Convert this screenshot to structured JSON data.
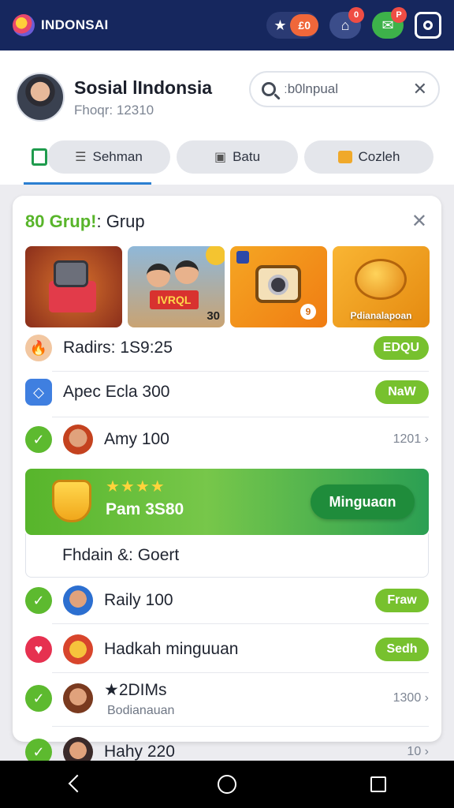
{
  "app": {
    "brand": "INDONSAI"
  },
  "topbar": {
    "star_value": "£0",
    "home_badge": "0",
    "chat_badge": "P"
  },
  "profile": {
    "name": "Sosial lIndonsia",
    "subtitle": "Fhoqr: 12310",
    "search_value": "ːb0lnpual"
  },
  "tabs": [
    {
      "label": "Sehman",
      "icon": "list-icon"
    },
    {
      "label": "Batu",
      "icon": "book-icon"
    },
    {
      "label": "Cozleh",
      "icon": "briefcase-icon"
    }
  ],
  "card": {
    "title_accent": "80 Grup!",
    "title_rest": ": Grup",
    "tiles": [
      {
        "name": "gift-camera-tile"
      },
      {
        "name": "friends-tile",
        "sign": "IVRQL",
        "tag": "30"
      },
      {
        "name": "camera-tile",
        "num": "9"
      },
      {
        "name": "heart-tile",
        "caption": "Pdianalapoan"
      }
    ],
    "rows": [
      {
        "label": "Radirs: 1S9:25",
        "action": "EDQU",
        "lead_icon": "flame-icon"
      },
      {
        "label": "Apec Ecla 300",
        "action": "NaW",
        "lead_icon": "app-icon"
      },
      {
        "label": "Amy 100",
        "meta": "1201 ›",
        "lead_icon": "check-icon"
      }
    ],
    "promo": {
      "stars": "★★★★",
      "text": "Pam 3S80",
      "cta": "Minguaɑn",
      "footer": "Fhdain &: Goert"
    },
    "rows2": [
      {
        "label": "Raily 100",
        "action": "Fraw",
        "lead_icon": "check-icon"
      },
      {
        "label": "Hadkah minguuan",
        "action": "Sedh",
        "lead_icon": "heart-icon"
      },
      {
        "label": "★2DIMs",
        "sublabel": "Bodianauan",
        "meta": "1300 ›",
        "lead_icon": "check-icon"
      },
      {
        "label": "Hahy 220",
        "meta": "10 ›",
        "lead_icon": "check-icon"
      }
    ]
  },
  "colors": {
    "topbar": "#16275e",
    "accent_green": "#77c12e",
    "active_underline": "#2b7fd1"
  }
}
